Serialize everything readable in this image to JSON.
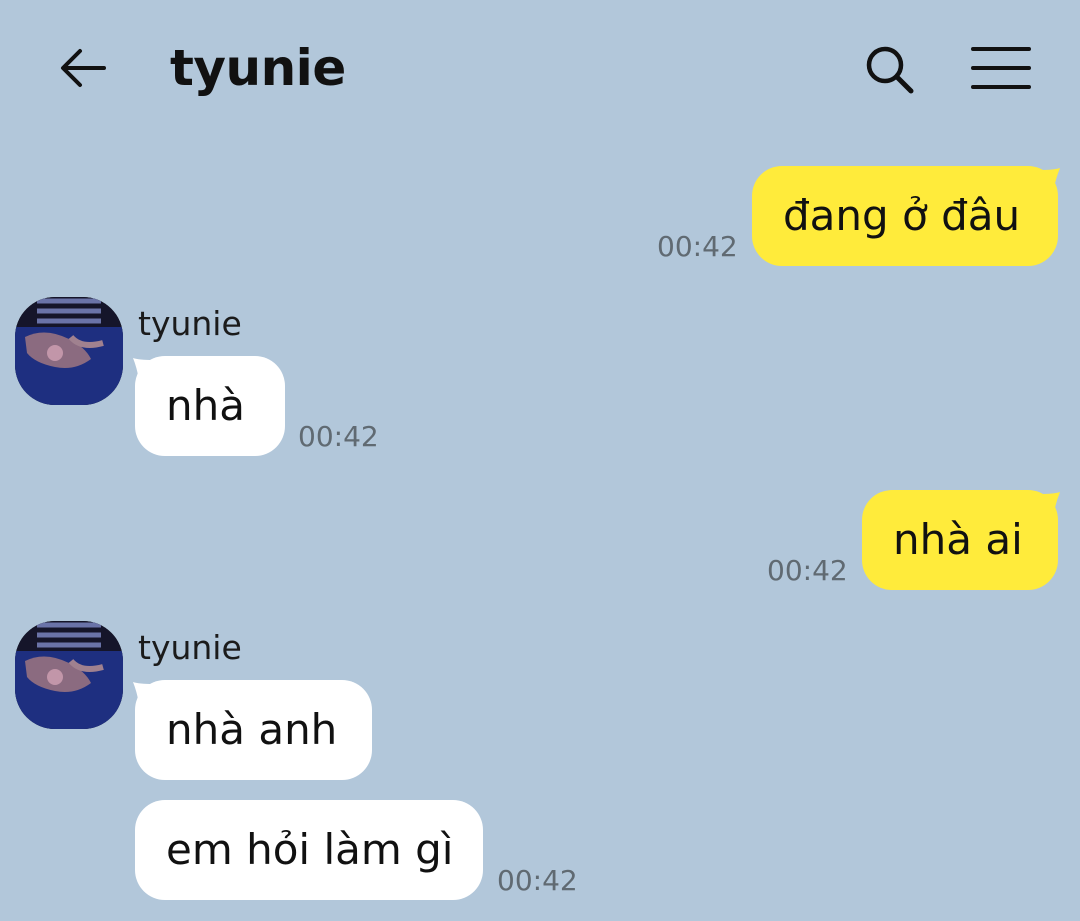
{
  "header": {
    "title": "tyunie",
    "back_icon": "arrow-left-icon",
    "search_icon": "search-icon",
    "menu_icon": "menu-icon"
  },
  "colors": {
    "background": "#b2c7da",
    "outgoing_bubble": "#ffeb3b",
    "incoming_bubble": "#ffffff",
    "timestamp": "#606a72"
  },
  "messages": [
    {
      "direction": "outgoing",
      "text": "đang ở đâu",
      "time": "00:42"
    },
    {
      "direction": "incoming",
      "sender": "tyunie",
      "text": "nhà",
      "time": "00:42"
    },
    {
      "direction": "outgoing",
      "text": "nhà ai",
      "time": "00:42"
    },
    {
      "direction": "incoming",
      "sender": "tyunie",
      "text": "nhà anh",
      "time": ""
    },
    {
      "direction": "incoming",
      "text": "em hỏi làm gì",
      "time": "00:42"
    }
  ]
}
